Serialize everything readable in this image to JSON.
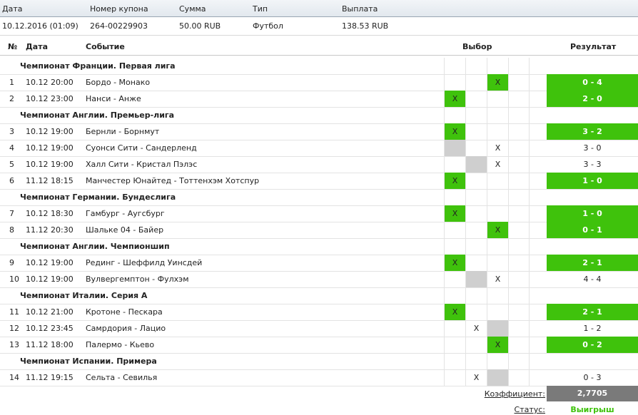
{
  "coupon": {
    "headers": [
      "Дата",
      "Номер купона",
      "Сумма",
      "Тип",
      "Выплата"
    ],
    "values": [
      "10.12.2016 (01:09)",
      "264-00229903",
      "50.00 RUB",
      "Футбол",
      "138.53 RUB"
    ]
  },
  "table": {
    "headers": [
      "№",
      "Дата",
      "Событие",
      "Выбор",
      "Результат"
    ],
    "blocks": [
      {
        "league": "Чемпионат Франции. Первая лига",
        "rows": [
          {
            "no": "1",
            "date": "10.12 20:00",
            "event": "Бордо - Монако",
            "pick": [
              null,
              null,
              "green",
              null
            ],
            "result": "0 - 4",
            "win": true
          },
          {
            "no": "2",
            "date": "10.12 23:00",
            "event": "Нанси - Анже",
            "pick": [
              "green",
              null,
              null,
              null
            ],
            "result": "2 - 0",
            "win": true
          }
        ]
      },
      {
        "league": "Чемпионат Англии. Премьер-лига",
        "rows": [
          {
            "no": "3",
            "date": "10.12 19:00",
            "event": "Бернли - Борнмут",
            "pick": [
              "green",
              null,
              null,
              null
            ],
            "result": "3 - 2",
            "win": true
          },
          {
            "no": "4",
            "date": "10.12 19:00",
            "event": "Суонси Сити - Сандерленд",
            "pick": [
              "gray",
              null,
              "x",
              null
            ],
            "result": "3 - 0",
            "win": false
          },
          {
            "no": "5",
            "date": "10.12 19:00",
            "event": "Халл Сити - Кристал Пэлэс",
            "pick": [
              null,
              "gray",
              "x",
              null
            ],
            "result": "3 - 3",
            "win": false
          },
          {
            "no": "6",
            "date": "11.12 18:15",
            "event": "Манчестер Юнайтед - Тоттенхэм Хотспур",
            "pick": [
              "green",
              null,
              null,
              null
            ],
            "result": "1 - 0",
            "win": true
          }
        ]
      },
      {
        "league": "Чемпионат Германии. Бундеслига",
        "rows": [
          {
            "no": "7",
            "date": "10.12 18:30",
            "event": "Гамбург - Аугсбург",
            "pick": [
              "green",
              null,
              null,
              null
            ],
            "result": "1 - 0",
            "win": true
          },
          {
            "no": "8",
            "date": "11.12 20:30",
            "event": "Шальке 04 - Байер",
            "pick": [
              null,
              null,
              "green",
              null
            ],
            "result": "0 - 1",
            "win": true
          }
        ]
      },
      {
        "league": "Чемпионат Англии. Чемпионшип",
        "rows": [
          {
            "no": "9",
            "date": "10.12 19:00",
            "event": "Рединг - Шеффилд Уинсдей",
            "pick": [
              "green",
              null,
              null,
              null
            ],
            "result": "2 - 1",
            "win": true
          },
          {
            "no": "10",
            "date": "10.12 19:00",
            "event": "Вулвергемптон - Фулхэм",
            "pick": [
              null,
              "gray",
              "x",
              null
            ],
            "result": "4 - 4",
            "win": false
          }
        ]
      },
      {
        "league": "Чемпионат Италии. Серия А",
        "rows": [
          {
            "no": "11",
            "date": "10.12 21:00",
            "event": "Кротоне - Пескара",
            "pick": [
              "green",
              null,
              null,
              null
            ],
            "result": "2 - 1",
            "win": true
          },
          {
            "no": "12",
            "date": "10.12 23:45",
            "event": "Самрдория - Лацио",
            "pick": [
              null,
              "x",
              "gray",
              null
            ],
            "result": "1 - 2",
            "win": false
          },
          {
            "no": "13",
            "date": "11.12 18:00",
            "event": "Палермо - Кьево",
            "pick": [
              null,
              null,
              "green",
              null
            ],
            "result": "0 - 2",
            "win": true
          }
        ]
      },
      {
        "league": "Чемпионат Испании. Примера",
        "rows": [
          {
            "no": "14",
            "date": "11.12 19:15",
            "event": "Сельта - Севилья",
            "pick": [
              null,
              "x",
              "gray",
              null
            ],
            "result": "0 - 3",
            "win": false
          }
        ]
      }
    ]
  },
  "mark": "X",
  "footer": {
    "coef_label": "Коэффициент:",
    "coef_value": "2,7705",
    "status_label": "Статус:",
    "status_value": "Выигрыш"
  },
  "colors": {
    "win": "#3fc20c",
    "gray": "#cfcfcf",
    "coef_bg": "#7a7a7a"
  }
}
